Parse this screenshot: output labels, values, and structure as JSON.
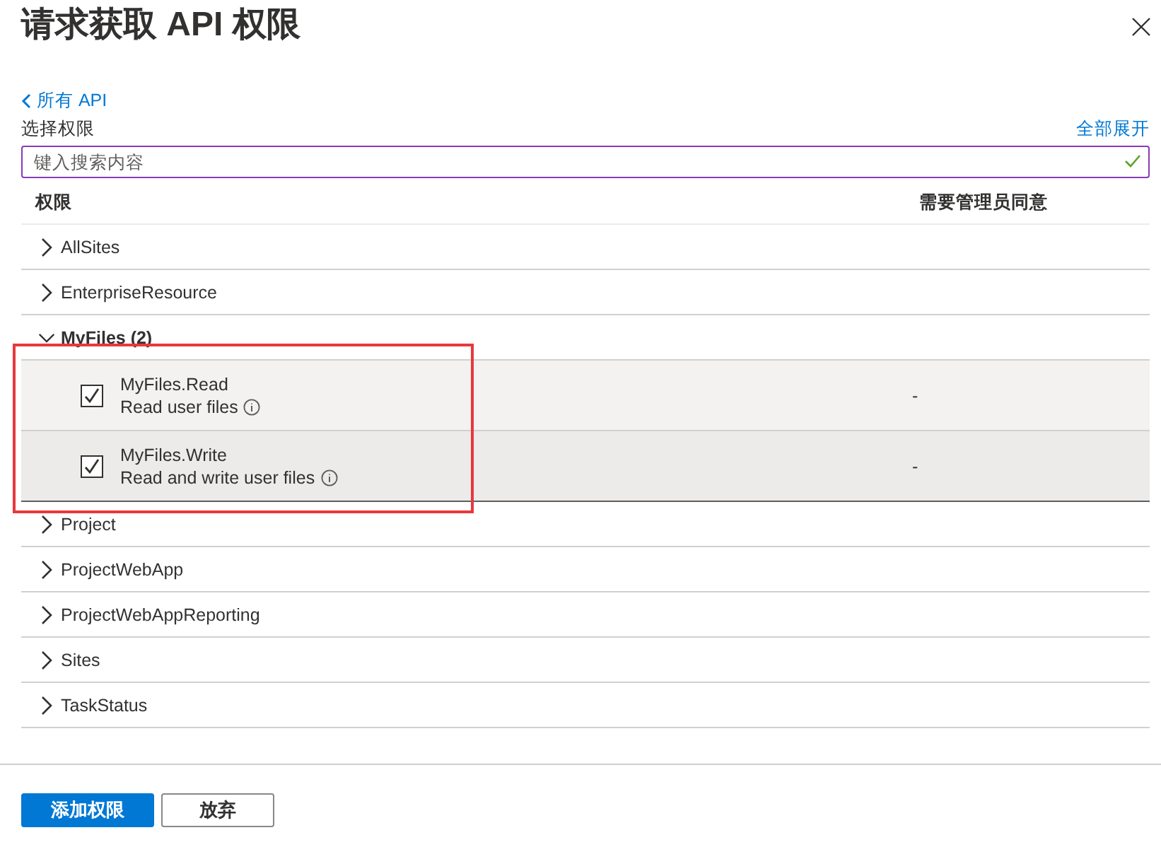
{
  "title": "请求获取 API 权限",
  "back_link": {
    "label": "所有 API"
  },
  "section_label": "选择权限",
  "expand_all": "全部展开",
  "search": {
    "placeholder": "键入搜索内容",
    "valid": true
  },
  "table": {
    "columns": [
      "权限",
      "需要管理员同意"
    ],
    "groups": [
      {
        "name": "AllSites",
        "expanded": false
      },
      {
        "name": "EnterpriseResource",
        "expanded": false
      },
      {
        "name": "MyFiles (2)",
        "expanded": true,
        "highlighted": true,
        "children": [
          {
            "name": "MyFiles.Read",
            "description": "Read user files",
            "checked": true,
            "hovered": false,
            "admin_consent": "-"
          },
          {
            "name": "MyFiles.Write",
            "description": "Read and write user files",
            "checked": true,
            "hovered": true,
            "admin_consent": "-"
          }
        ]
      },
      {
        "name": "Project",
        "expanded": false
      },
      {
        "name": "ProjectWebApp",
        "expanded": false
      },
      {
        "name": "ProjectWebAppReporting",
        "expanded": false
      },
      {
        "name": "Sites",
        "expanded": false
      },
      {
        "name": "TaskStatus",
        "expanded": false
      }
    ]
  },
  "buttons": [
    {
      "label": "添加权限",
      "kind": "primary"
    },
    {
      "label": "放弃",
      "kind": "secondary"
    }
  ]
}
